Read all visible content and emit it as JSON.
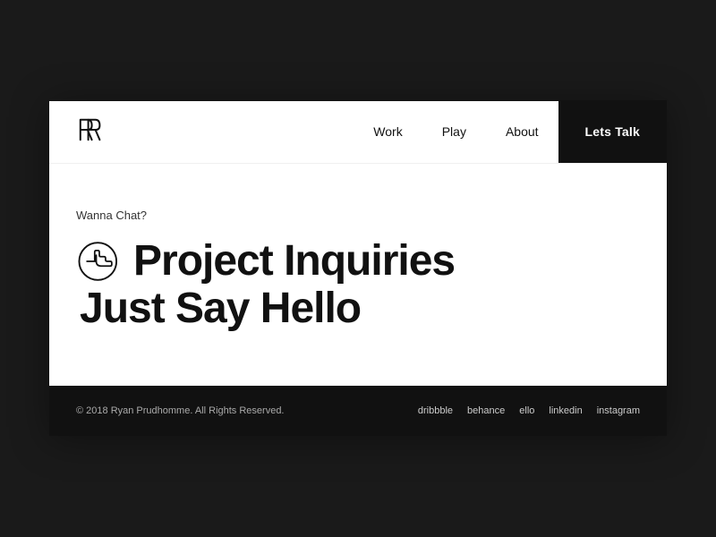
{
  "nav": {
    "logo_text": "RR",
    "links": [
      {
        "label": "Work",
        "id": "work"
      },
      {
        "label": "Play",
        "id": "play"
      },
      {
        "label": "About",
        "id": "about"
      }
    ],
    "cta_label": "Lets Talk"
  },
  "main": {
    "subheading": "Wanna Chat?",
    "headline_line1": "Project Inquiries",
    "headline_line2": "Just Say Hello"
  },
  "footer": {
    "copyright": "© 2018 Ryan Prudhomme. All Rights Reserved.",
    "social_links": [
      {
        "label": "dribbble"
      },
      {
        "label": "behance"
      },
      {
        "label": "ello"
      },
      {
        "label": "linkedin"
      },
      {
        "label": "instagram"
      }
    ]
  }
}
